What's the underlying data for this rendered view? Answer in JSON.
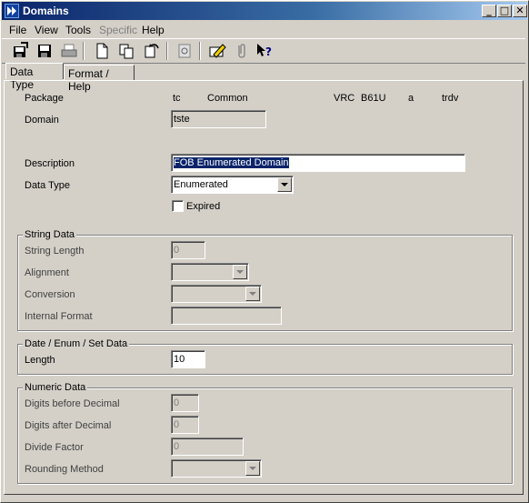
{
  "window": {
    "title": "Domains"
  },
  "title_buttons": {
    "minimize": "_",
    "maximize": "□",
    "close": "✕"
  },
  "menu": [
    {
      "label": "File",
      "disabled": false
    },
    {
      "label": "View",
      "disabled": false
    },
    {
      "label": "Tools",
      "disabled": false
    },
    {
      "label": "Specific",
      "disabled": true
    },
    {
      "label": "Help",
      "disabled": false
    }
  ],
  "toolbar_icons": [
    "save-close-icon",
    "save-icon",
    "print-icon",
    "new-document-icon",
    "copy-icon",
    "undo-icon",
    "refresh-icon",
    "edit-pencil-icon",
    "attach-icon",
    "whats-this-help-icon"
  ],
  "tabs": [
    {
      "label": "Data Type",
      "active": true
    },
    {
      "label": "Format / Help",
      "active": false
    }
  ],
  "header": {
    "package_label": "Package",
    "package_code": "tc",
    "package_name": "Common",
    "vrc_label": "VRC",
    "vrc_value": "B61U",
    "vrc_a": "a",
    "vrc_trdv": "trdv",
    "domain_label": "Domain",
    "domain_value": "tste"
  },
  "description": {
    "label": "Description",
    "value": "FOB Enumerated Domain"
  },
  "data_type": {
    "label": "Data Type",
    "value": "Enumerated"
  },
  "expired": {
    "label": "Expired",
    "checked": false
  },
  "string_data": {
    "title": "String Data",
    "length_label": "String Length",
    "length_value": "0",
    "alignment_label": "Alignment",
    "alignment_value": "",
    "conversion_label": "Conversion",
    "conversion_value": "",
    "internal_format_label": "Internal Format",
    "internal_format_value": ""
  },
  "date_enum_set": {
    "title": "Date / Enum / Set Data",
    "length_label": "Length",
    "length_value": "10"
  },
  "numeric_data": {
    "title": "Numeric Data",
    "digits_before_label": "Digits before Decimal",
    "digits_before_value": "0",
    "digits_after_label": "Digits after Decimal",
    "digits_after_value": "0",
    "divide_factor_label": "Divide Factor",
    "divide_factor_value": "0",
    "rounding_label": "Rounding Method",
    "rounding_value": ""
  }
}
